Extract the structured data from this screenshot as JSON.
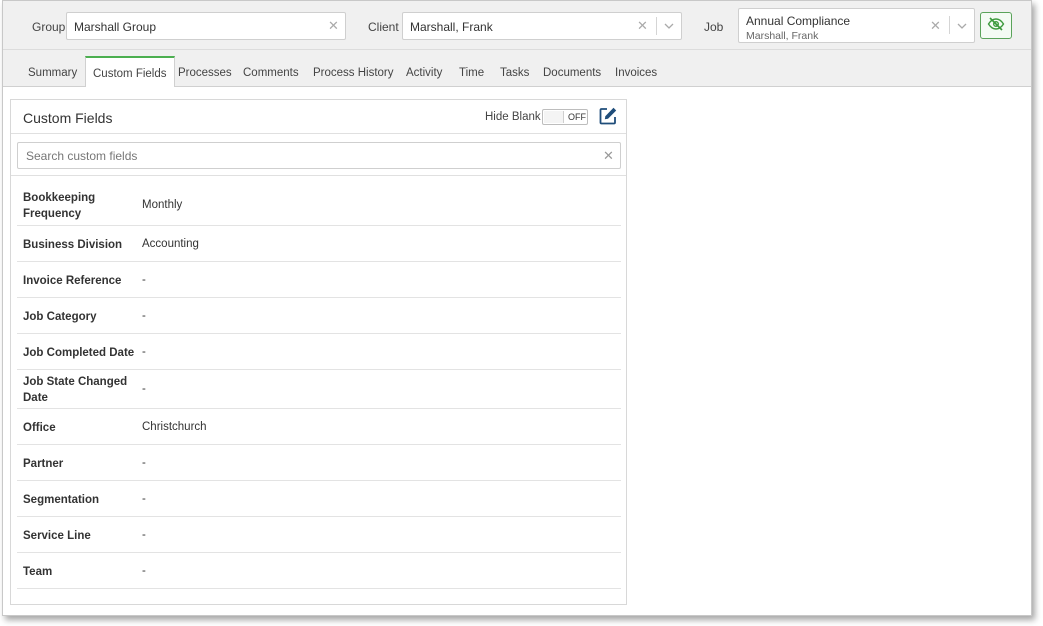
{
  "filters": {
    "group": {
      "label": "Group",
      "value": "Marshall Group"
    },
    "client": {
      "label": "Client",
      "value": "Marshall, Frank"
    },
    "job": {
      "label": "Job",
      "value": "Annual Compliance",
      "subvalue": "Marshall, Frank"
    },
    "visibility_icon": "eye-slash-icon"
  },
  "tabs": [
    {
      "label": "Summary"
    },
    {
      "label": "Custom Fields",
      "active": true
    },
    {
      "label": "Processes"
    },
    {
      "label": "Comments"
    },
    {
      "label": "Process History"
    },
    {
      "label": "Activity"
    },
    {
      "label": "Time"
    },
    {
      "label": "Tasks"
    },
    {
      "label": "Documents"
    },
    {
      "label": "Invoices"
    }
  ],
  "panel": {
    "title": "Custom Fields",
    "hide_blank_label": "Hide Blank",
    "toggle_state": "OFF",
    "edit_icon": "edit-icon",
    "search_placeholder": "Search custom fields",
    "fields": [
      {
        "label": "Bookkeeping Frequency",
        "value": "Monthly"
      },
      {
        "label": "Business Division",
        "value": "Accounting"
      },
      {
        "label": "Invoice Reference",
        "value": "-"
      },
      {
        "label": "Job Category",
        "value": "-"
      },
      {
        "label": "Job Completed Date",
        "value": "-"
      },
      {
        "label": "Job State Changed Date",
        "value": "-"
      },
      {
        "label": "Office",
        "value": "Christchurch"
      },
      {
        "label": "Partner",
        "value": "-"
      },
      {
        "label": "Segmentation",
        "value": "-"
      },
      {
        "label": "Service Line",
        "value": "-"
      },
      {
        "label": "Team",
        "value": "-"
      }
    ]
  },
  "colors": {
    "accent": "#4caf50",
    "border": "#cfcfcf"
  }
}
